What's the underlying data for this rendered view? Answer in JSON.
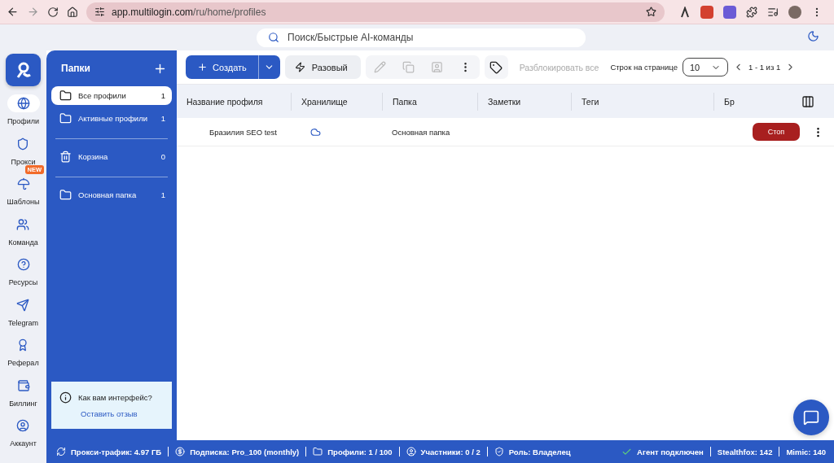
{
  "browser": {
    "url_host": "app.multilogin.com",
    "url_path": "/ru/home/profiles"
  },
  "search": {
    "placeholder": "Поиск/Быстрые AI-команды"
  },
  "nav": [
    {
      "kind": "profiles",
      "label": "Профили",
      "selected": true
    },
    {
      "kind": "proxy",
      "label": "Прокси",
      "selected": false
    },
    {
      "kind": "templates",
      "label": "Шаблоны",
      "selected": false,
      "badge": "NEW"
    },
    {
      "kind": "team",
      "label": "Команда",
      "selected": false
    },
    {
      "kind": "help",
      "label": "Ресурсы",
      "selected": false
    },
    {
      "kind": "telegram",
      "label": "Telegram",
      "selected": false
    },
    {
      "kind": "referral",
      "label": "Реферал",
      "selected": false
    },
    {
      "kind": "billing",
      "label": "Биллинг",
      "selected": false
    },
    {
      "kind": "account",
      "label": "Аккаунт",
      "selected": false
    }
  ],
  "folders": {
    "title": "Папки",
    "items": [
      {
        "kind": "folder",
        "label": "Все профили",
        "count": "1",
        "selected": true
      },
      {
        "kind": "folder",
        "label": "Активные профили",
        "count": "1",
        "selected": false
      },
      {
        "kind": "trash",
        "label": "Корзина",
        "count": "0",
        "selected": false
      },
      {
        "kind": "folder",
        "label": "Основная папка",
        "count": "1",
        "selected": false
      }
    ],
    "feedback": {
      "question": "Как вам интерфейс?",
      "link": "Оставить отзыв"
    }
  },
  "toolbar": {
    "create": "Создать",
    "oneoff": "Разовый",
    "unlock": {
      "label": "Разблокировать все",
      "disabled": true
    },
    "rows_label": "Строк на странице",
    "rows_value": "10",
    "pagination": "1 - 1 из 1"
  },
  "table": {
    "columns": [
      "Название профиля",
      "Хранилище",
      "Папка",
      "Заметки",
      "Теги",
      "Бр"
    ],
    "rows": [
      {
        "name": "Бразилия SEO test",
        "folder": "Основная папка",
        "action": "Стоп"
      }
    ]
  },
  "status_bar": {
    "items": [
      {
        "kind": "traffic",
        "text": "Прокси-трафик: 4.97 ГБ"
      },
      {
        "kind": "plan",
        "text": "Подписка: Pro_100 (monthly)"
      },
      {
        "kind": "profiles",
        "text": "Профили: 1 / 100"
      },
      {
        "kind": "members",
        "text": "Участники: 0 / 2"
      },
      {
        "kind": "role",
        "text": "Роль: Владелец"
      }
    ],
    "agent": "Агент подключен",
    "right": [
      "Stealthfox: 142",
      "Mimic: 140"
    ]
  }
}
